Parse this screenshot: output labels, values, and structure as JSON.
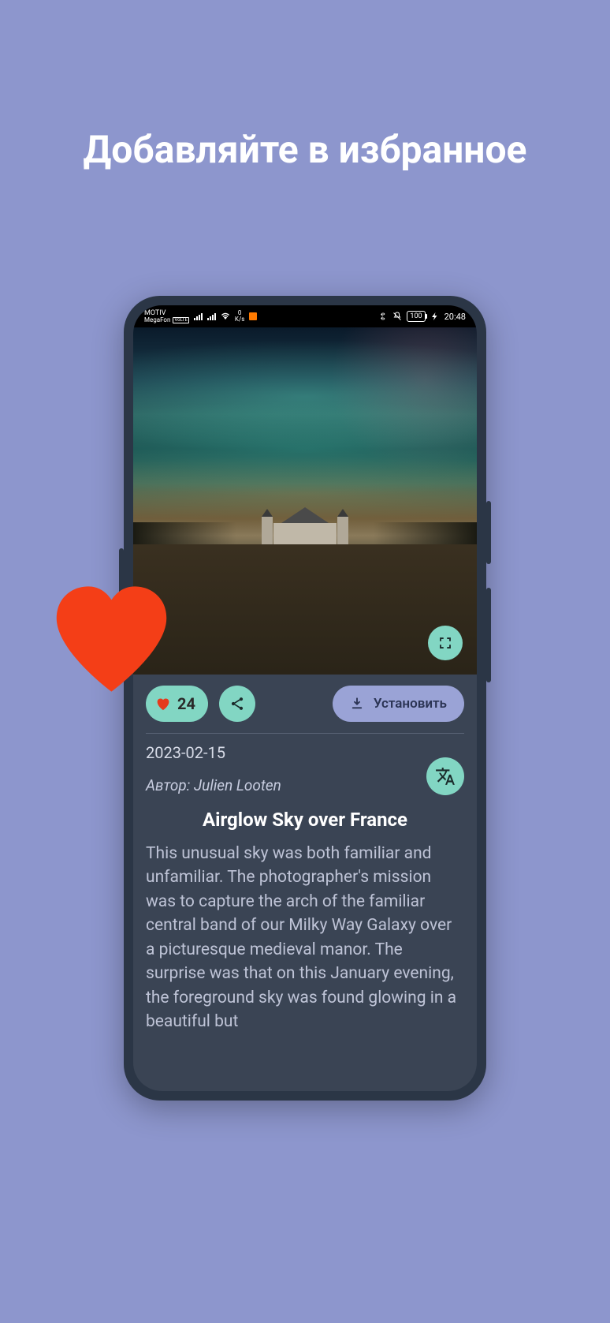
{
  "promo": {
    "title": "Добавляйте в избранное"
  },
  "status": {
    "carrier1": "MOTIV",
    "carrier2": "MegaFon",
    "net_label": "0\nK/s",
    "battery": "100",
    "time": "20:48"
  },
  "actions": {
    "like_count": "24",
    "install_label": "Установить"
  },
  "meta": {
    "date": "2023-02-15",
    "author_prefix": "Автор:",
    "author_name": "Julien Looten"
  },
  "article": {
    "title": "Airglow Sky over France",
    "body": "This unusual sky was both familiar and unfamiliar. The photographer's mission was to capture the arch of the familiar central band of our Milky Way Galaxy over a picturesque medieval manor.  The surprise was that on this January evening, the foreground sky was found glowing in a beautiful but"
  },
  "colors": {
    "accent_teal": "#82d6c3",
    "accent_purple": "#9aa3d6",
    "heart_red": "#f43e17"
  }
}
